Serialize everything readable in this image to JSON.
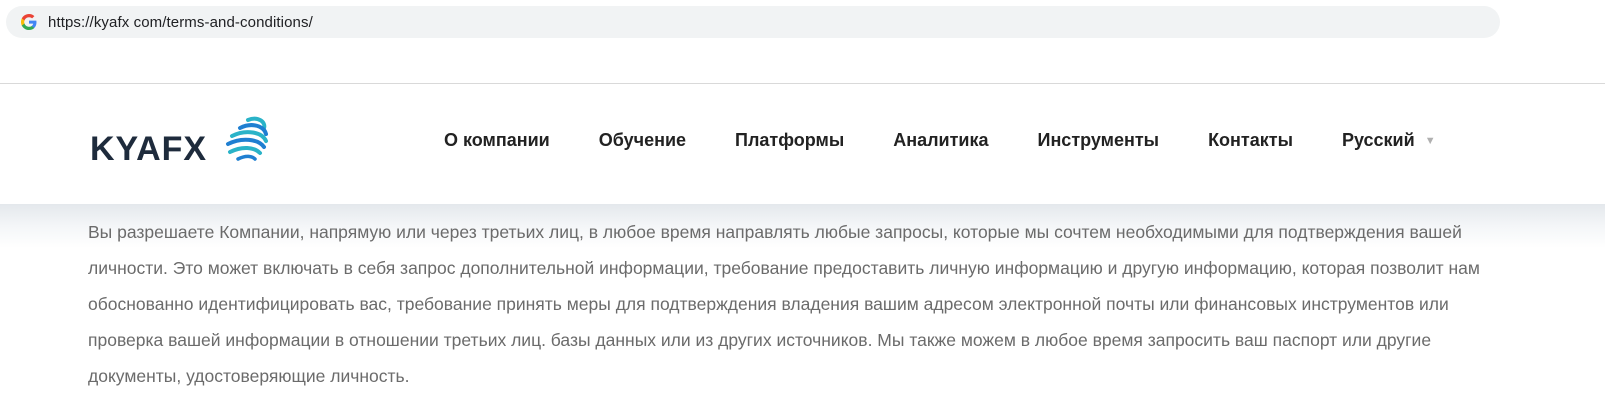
{
  "browser": {
    "url": "https://kyafx com/terms-and-conditions/",
    "favicon_icon": "google-g-icon"
  },
  "header": {
    "logo_text": "KYAFX",
    "logo_icon": "globe-icon",
    "nav": [
      {
        "label": "О компании"
      },
      {
        "label": "Обучение"
      },
      {
        "label": "Платформы"
      },
      {
        "label": "Аналитика"
      },
      {
        "label": "Инструменты"
      },
      {
        "label": "Контакты"
      }
    ],
    "language": {
      "label": "Русский",
      "caret_icon": "triangle-down-icon"
    }
  },
  "content": {
    "paragraph": "Вы разрешаете Компании, напрямую или через третьих лиц, в любое время направлять любые запросы, которые мы сочтем необходимыми для подтверждения вашей личности. Это может включать в себя запрос дополнительной информации, требование предоставить личную информацию и другую информацию, которая позволит нам обоснованно идентифицировать вас, требование принять меры для подтверждения владения вашим адресом электронной почты или финансовых инструментов или проверка вашей информации в отношении третьих лиц. базы данных или из других источников. Мы также можем в любое время запросить ваш паспорт или другие документы, удостоверяющие личность."
  },
  "colors": {
    "logo_text": "#1e2b3c",
    "logo_blue": "#1f7fd1",
    "logo_teal": "#2ab3c8",
    "nav_text": "#222222",
    "body_text": "#6b6b6b"
  }
}
